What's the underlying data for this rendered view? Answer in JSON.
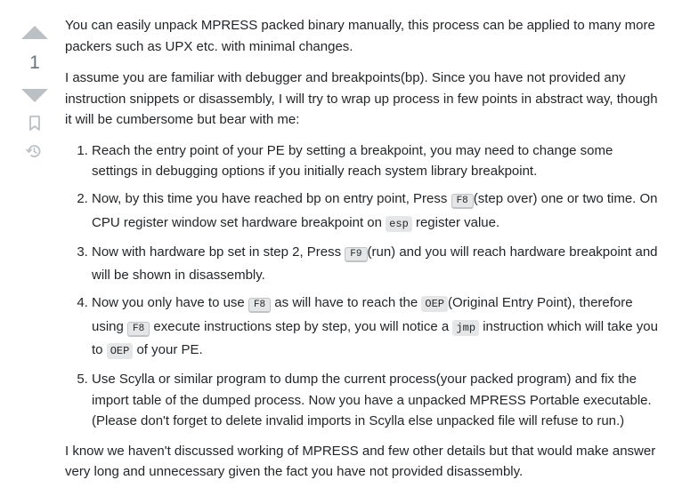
{
  "votes": {
    "count": "1"
  },
  "answer": {
    "para1": "You can easily unpack MPRESS packed binary manually, this process can be applied to many more packers such as UPX etc. with minimal changes.",
    "para2": "I assume you are familiar with debugger and breakpoints(bp). Since you have not provided any instruction snippets or disassembly, I will try to wrap up process in few points in abstract way, though it will be cumbersome but bear with me:",
    "steps": [
      {
        "text": "Reach the entry point of your PE by setting a breakpoint, you may need to change some settings in debugging options if you initially reach system library breakpoint."
      },
      {
        "a": "Now, by this time you have reached bp on entry point, Press ",
        "key": "F8",
        "b": "(step over) one or two time. On CPU register window set hardware breakpoint on ",
        "code": "esp",
        "c": " register value."
      },
      {
        "a": "Now with hardware bp set in step 2, Press ",
        "key": "F9",
        "b": "(run) and you will reach hardware breakpoint and will be shown in disassembly."
      },
      {
        "a": "Now you only have to use ",
        "key1": "F8",
        "b": " as will have to reach the ",
        "code1": "OEP",
        "c": "(Original Entry Point), therefore using ",
        "key2": "F8",
        "d": " execute instructions step by step, you will notice a ",
        "code2": "jmp",
        "e": " instruction which will take you to ",
        "code3": "OEP",
        "f": " of your PE."
      },
      {
        "text": "Use Scylla or similar program to dump the current process(your packed program) and fix the import table of the dumped process. Now you have a unpacked MPRESS Portable executable. (Please don't forget to delete invalid imports in Scylla else unpacked file will refuse to run.)"
      }
    ],
    "para3": "I know we haven't discussed working of MPRESS and few other details but that would make answer very long and unnecessary given the fact you have not provided disassembly."
  },
  "icons": {
    "upvote": "triangle-up-icon",
    "downvote": "triangle-down-icon",
    "bookmark": "bookmark-icon",
    "history": "history-icon"
  },
  "colors": {
    "vote_arrow": "#bbc0c4",
    "vote_count": "#6a737c",
    "text": "#232629",
    "code_bg": "#e4e6e8"
  }
}
